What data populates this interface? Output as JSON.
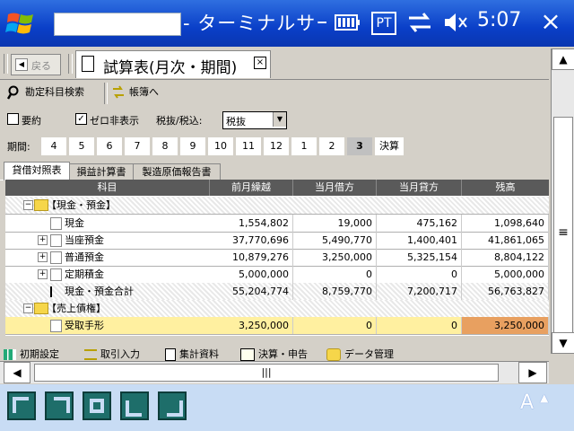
{
  "titlebar": {
    "title": "- ターミナルサート",
    "clock": "5:07",
    "close": "×",
    "tray_pt": "PT"
  },
  "nav": {
    "back_label": "戻る",
    "doc_title": "試算表(月次・期間)",
    "doc_close": "×"
  },
  "toolbar": {
    "search_label": "勘定科目検索",
    "ledger_label": "帳簿へ"
  },
  "options": {
    "summary_label": "要約",
    "zero_label": "ゼロ非表示",
    "summary_checked": false,
    "zero_checked": true,
    "tax_label": "税抜/税込:",
    "tax_value": "税抜"
  },
  "period": {
    "label": "期間:",
    "months": [
      "4",
      "5",
      "6",
      "7",
      "8",
      "9",
      "10",
      "11",
      "12",
      "1",
      "2",
      "3"
    ],
    "selected": "3",
    "final": "決算"
  },
  "report_tabs": [
    "貸借対照表",
    "損益計算書",
    "製造原価報告書"
  ],
  "grid": {
    "headers": [
      "科目",
      "前月繰越",
      "当月借方",
      "当月貸方",
      "残高"
    ],
    "rows": [
      {
        "name": "【現金・預金】",
        "v": [
          "",
          "",
          "",
          ""
        ]
      },
      {
        "name": "現金",
        "v": [
          "1,554,802",
          "19,000",
          "475,162",
          "1,098,640"
        ]
      },
      {
        "name": "当座預金",
        "v": [
          "37,770,696",
          "5,490,770",
          "1,400,401",
          "41,861,065"
        ]
      },
      {
        "name": "普通預金",
        "v": [
          "10,879,276",
          "3,250,000",
          "5,325,154",
          "8,804,122"
        ]
      },
      {
        "name": "定期積金",
        "v": [
          "5,000,000",
          "0",
          "0",
          "5,000,000"
        ]
      },
      {
        "name": "現金・預金合計",
        "v": [
          "55,204,774",
          "8,759,770",
          "7,200,717",
          "56,763,827"
        ]
      },
      {
        "name": "【売上債権】",
        "v": [
          "",
          "",
          "",
          ""
        ]
      },
      {
        "name": "受取手形",
        "v": [
          "3,250,000",
          "0",
          "0",
          "3,250,000"
        ]
      }
    ]
  },
  "bottom_menu": [
    "初期設定",
    "取引入力",
    "集計資料",
    "決算・申告",
    "データ管理"
  ],
  "sip_label": "A"
}
